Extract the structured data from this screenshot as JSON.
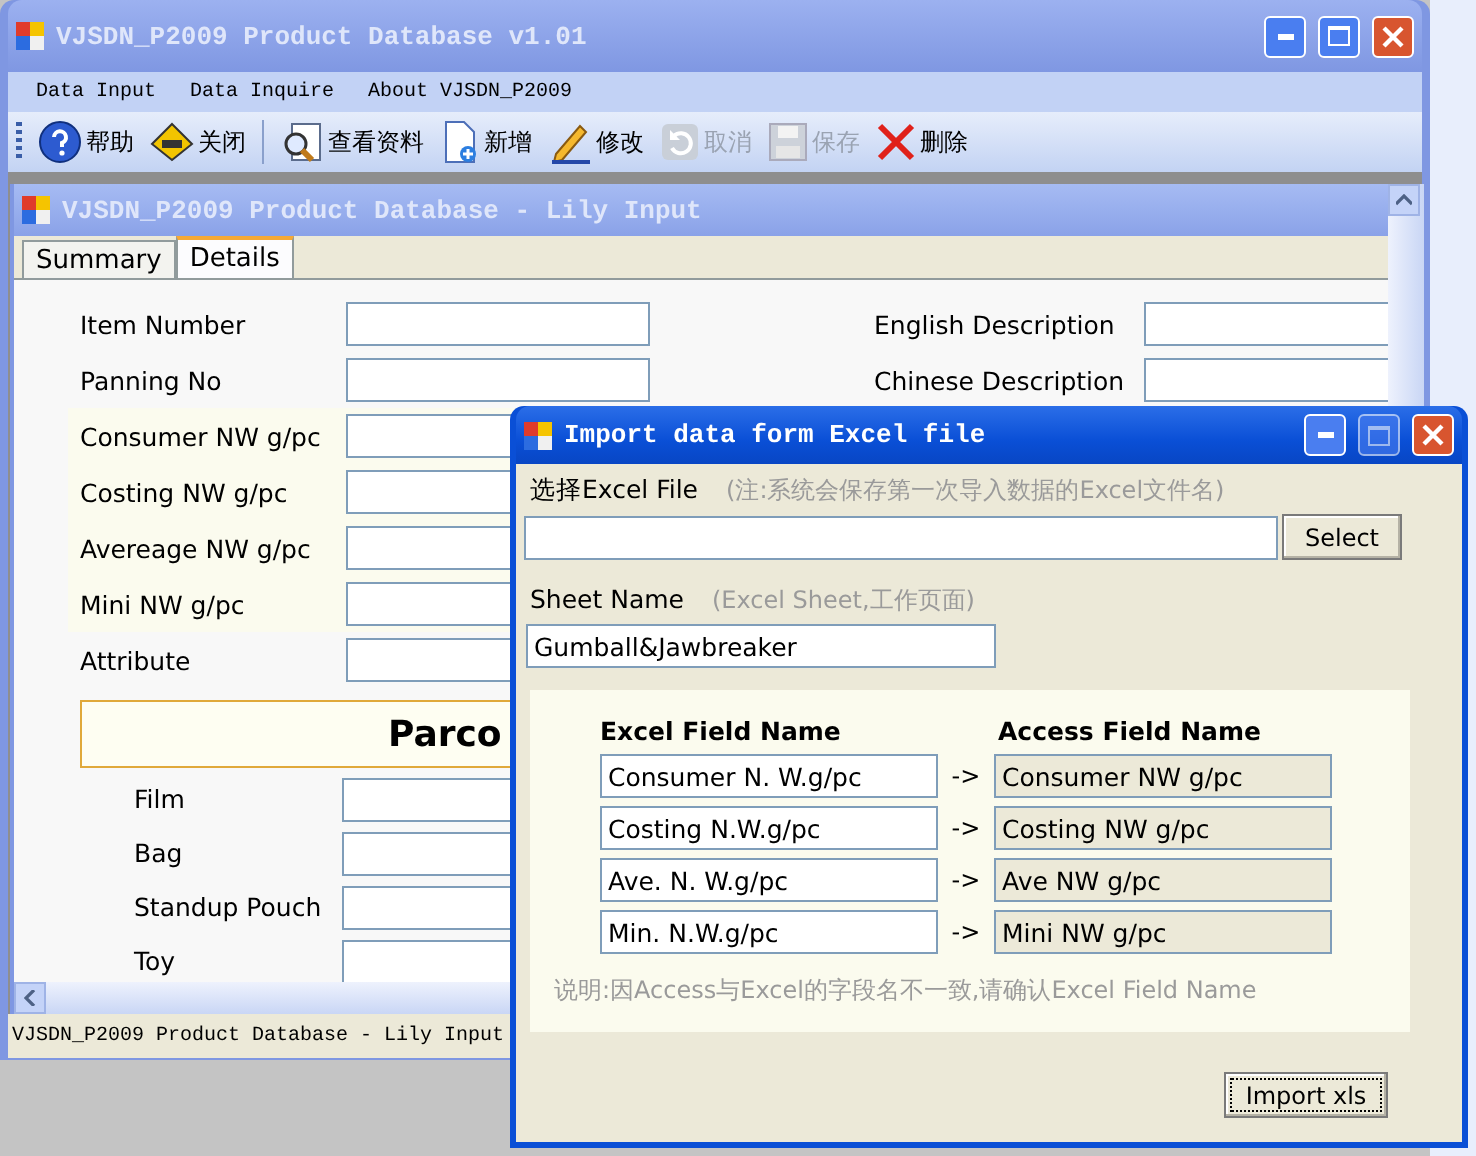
{
  "main_window": {
    "title": "VJSDN_P2009 Product Database v1.01",
    "menu": [
      "Data Input",
      "Data Inquire",
      "About VJSDN_P2009"
    ],
    "toolbar": [
      {
        "label": "帮助",
        "kind": "help",
        "disabled": false
      },
      {
        "label": "关闭",
        "kind": "exit",
        "disabled": false
      },
      {
        "label": "查看资料",
        "kind": "view",
        "disabled": false
      },
      {
        "label": "新增",
        "kind": "new",
        "disabled": false
      },
      {
        "label": "修改",
        "kind": "edit",
        "disabled": false
      },
      {
        "label": "取消",
        "kind": "cancel",
        "disabled": true
      },
      {
        "label": "保存",
        "kind": "save",
        "disabled": true
      },
      {
        "label": "删除",
        "kind": "delete",
        "disabled": false
      }
    ],
    "child_window": {
      "title": "VJSDN_P2009 Product Database - Lily Input",
      "tabs": [
        {
          "label": "Summary",
          "selected": false
        },
        {
          "label": "Details",
          "selected": true
        }
      ],
      "left_fields": [
        {
          "label": "Item Number"
        },
        {
          "label": "Panning No"
        }
      ],
      "weight_fields": [
        {
          "label": "Consumer NW g/pc"
        },
        {
          "label": "Costing NW g/pc"
        },
        {
          "label": "Avereage NW g/pc"
        },
        {
          "label": "Mini NW g/pc"
        }
      ],
      "attribute_fields": [
        {
          "label": "Attribute"
        }
      ],
      "right_fields": [
        {
          "label": "English Description"
        },
        {
          "label": "Chinese Description"
        }
      ],
      "section_title": "Parco",
      "pack_fields": [
        {
          "label": "Film"
        },
        {
          "label": "Bag"
        },
        {
          "label": "Standup Pouch"
        },
        {
          "label": "Toy"
        }
      ]
    },
    "status_bar": "VJSDN_P2009 Product Database - Lily Input"
  },
  "dialog": {
    "title": "Import data form Excel file",
    "file_label": "选择Excel File",
    "file_note": "(注:系统会保存第一次导入数据的Excel文件名)",
    "select_button": "Select",
    "sheet_label": "Sheet Name",
    "sheet_note": "(Excel Sheet,工作页面)",
    "sheet_value": "Gumball&Jawbreaker",
    "excel_header": "Excel Field Name",
    "access_header": "Access Field Name",
    "rows": [
      {
        "excel": "Consumer N. W.g/pc",
        "arrow": "->",
        "access": "Consumer NW g/pc"
      },
      {
        "excel": "Costing N.W.g/pc",
        "arrow": "->",
        "access": "Costing NW g/pc"
      },
      {
        "excel": "Ave. N. W.g/pc",
        "arrow": "->",
        "access": "Ave NW g/pc"
      },
      {
        "excel": "Min. N.W.g/pc",
        "arrow": "->",
        "access": "Mini NW g/pc"
      }
    ],
    "note": "说明:因Access与Excel的字段名不一致,请确认Excel Field Name",
    "import_button": "Import xls"
  }
}
